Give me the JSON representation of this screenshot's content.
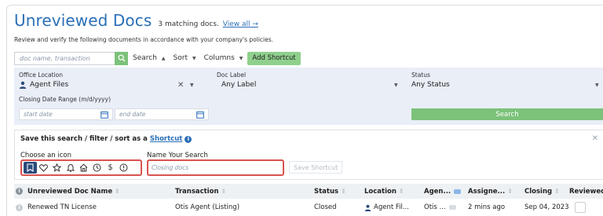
{
  "header": {
    "title": "Unreviewed Docs",
    "match_count": "3 matching docs.",
    "view_all": "View all →",
    "subtitle": "Review and verify the following documents in accordance with your company's policies."
  },
  "toolbar": {
    "search_placeholder": "doc name, transaction",
    "search_label": "Search",
    "sort_label": "Sort",
    "columns_label": "Columns",
    "add_shortcut_label": "Add Shortcut"
  },
  "filters": {
    "office_location_label": "Office Location",
    "office_location_value": "Agent Files",
    "doc_label_label": "Doc Label",
    "doc_label_value": "Any Label",
    "status_label": "Status",
    "status_value": "Any Status",
    "closing_date_label": "Closing Date Range (m/d/yyyy)",
    "start_date_placeholder": "start date",
    "end_date_placeholder": "end date",
    "search_button": "Search"
  },
  "shortcut": {
    "title_prefix": "Save this search / filter / sort as a",
    "title_link": "Shortcut",
    "choose_icon_label": "Choose an icon",
    "icons": [
      "bookmark-icon",
      "heart-icon",
      "star-icon",
      "bell-icon",
      "home-icon",
      "clock-icon",
      "dollar-icon",
      "alert-icon"
    ],
    "selected_icon": "bookmark-icon",
    "name_label": "Name Your Search",
    "name_placeholder": "Closing docs",
    "save_button": "Save Shortcut"
  },
  "table": {
    "columns": [
      "Unreviewed Doc Name",
      "Transaction",
      "Status",
      "Location",
      "Agen...",
      "Assigne...",
      "Closing",
      "Reviewed"
    ],
    "rows": [
      {
        "doc_name": "Renewed TN License",
        "transaction": "Otis Agent (Listing)",
        "status": "Closed",
        "location": "Agent Fil...",
        "agent": "Otis ...",
        "assignee": "2 mins ago",
        "closing": "Sep 04, 2023"
      }
    ]
  },
  "colors": {
    "accent": "#2a6fb8",
    "green": "#7cc27a",
    "highlight_red": "#d9534f",
    "panel_bg": "#e9eef7"
  }
}
